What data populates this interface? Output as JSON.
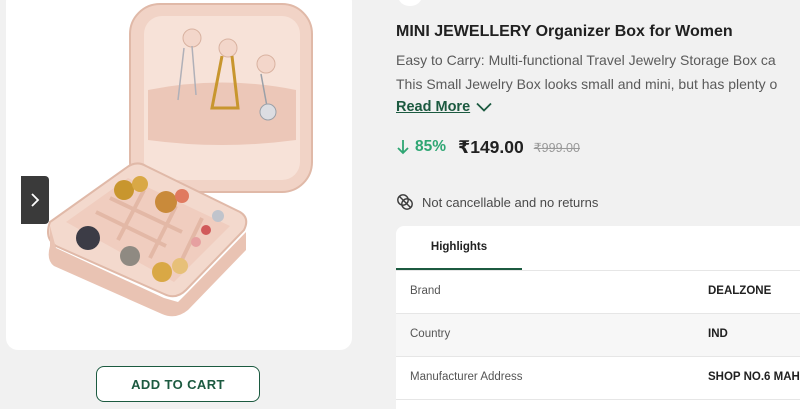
{
  "product": {
    "title": "MINI JEWELLERY Organizer Box for Women",
    "description_lines": [
      "Easy to Carry: Multi-functional Travel Jewelry Storage Box ca",
      "This Small Jewelry Box looks small and mini, but has plenty o"
    ],
    "read_more_label": "Read More",
    "discount_percent": "85%",
    "price": "₹149.00",
    "mrp": "₹999.00",
    "policy_text": "Not cancellable and no returns",
    "add_to_cart_label": "ADD TO CART",
    "image_icon": "jewellery-box-image"
  },
  "highlights": {
    "tab_label": "Highlights",
    "rows": [
      {
        "key": "Brand",
        "value": "DEALZONE"
      },
      {
        "key": "Country",
        "value": "IND"
      },
      {
        "key": "Manufacturer Address",
        "value": "SHOP NO.6 MAHAV"
      }
    ]
  },
  "icons": {
    "carousel_prev": "chevron-right-icon",
    "read_more": "chevron-down-icon",
    "discount": "arrow-down-icon",
    "policy": "no-return-icon"
  },
  "colors": {
    "accent": "#1c5a40",
    "discount": "#2ea673",
    "background": "#f1f1f1"
  }
}
